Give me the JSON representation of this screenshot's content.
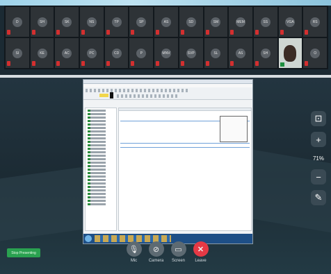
{
  "participants": {
    "row1": [
      {
        "initials": "D"
      },
      {
        "initials": "SH"
      },
      {
        "initials": "SK"
      },
      {
        "initials": "NS"
      },
      {
        "initials": "TP"
      },
      {
        "initials": "SP"
      },
      {
        "initials": "AS"
      },
      {
        "initials": "SD"
      },
      {
        "initials": "SM"
      },
      {
        "initials": "MEM"
      },
      {
        "initials": "SS"
      },
      {
        "initials": "VGA"
      },
      {
        "initials": "RS"
      }
    ],
    "row2": [
      {
        "initials": "SI"
      },
      {
        "initials": "KE"
      },
      {
        "initials": "AC"
      },
      {
        "initials": "PC"
      },
      {
        "initials": "CD"
      },
      {
        "initials": "P"
      },
      {
        "initials": "MNV"
      },
      {
        "initials": "SVP"
      },
      {
        "initials": "SL"
      },
      {
        "initials": "AS"
      },
      {
        "initials": "SH"
      },
      {
        "initials": ""
      },
      {
        "initials": "O"
      }
    ]
  },
  "zoom": {
    "level": "71%"
  },
  "stop_presenting": {
    "label": "Stop Presenting"
  },
  "controls": [
    {
      "label": "Mic",
      "icon": "mic-off-icon",
      "glyph": "🎙"
    },
    {
      "label": "Camera",
      "icon": "camera-off-icon",
      "glyph": "⊘"
    },
    {
      "label": "Screen",
      "icon": "screen-share-icon",
      "glyph": "▭"
    },
    {
      "label": "Leave",
      "icon": "close-icon",
      "glyph": "✕"
    }
  ],
  "colors": {
    "leave": "#e53945",
    "mic_muted": "#d32f2f",
    "presenting": "#2aa150"
  }
}
